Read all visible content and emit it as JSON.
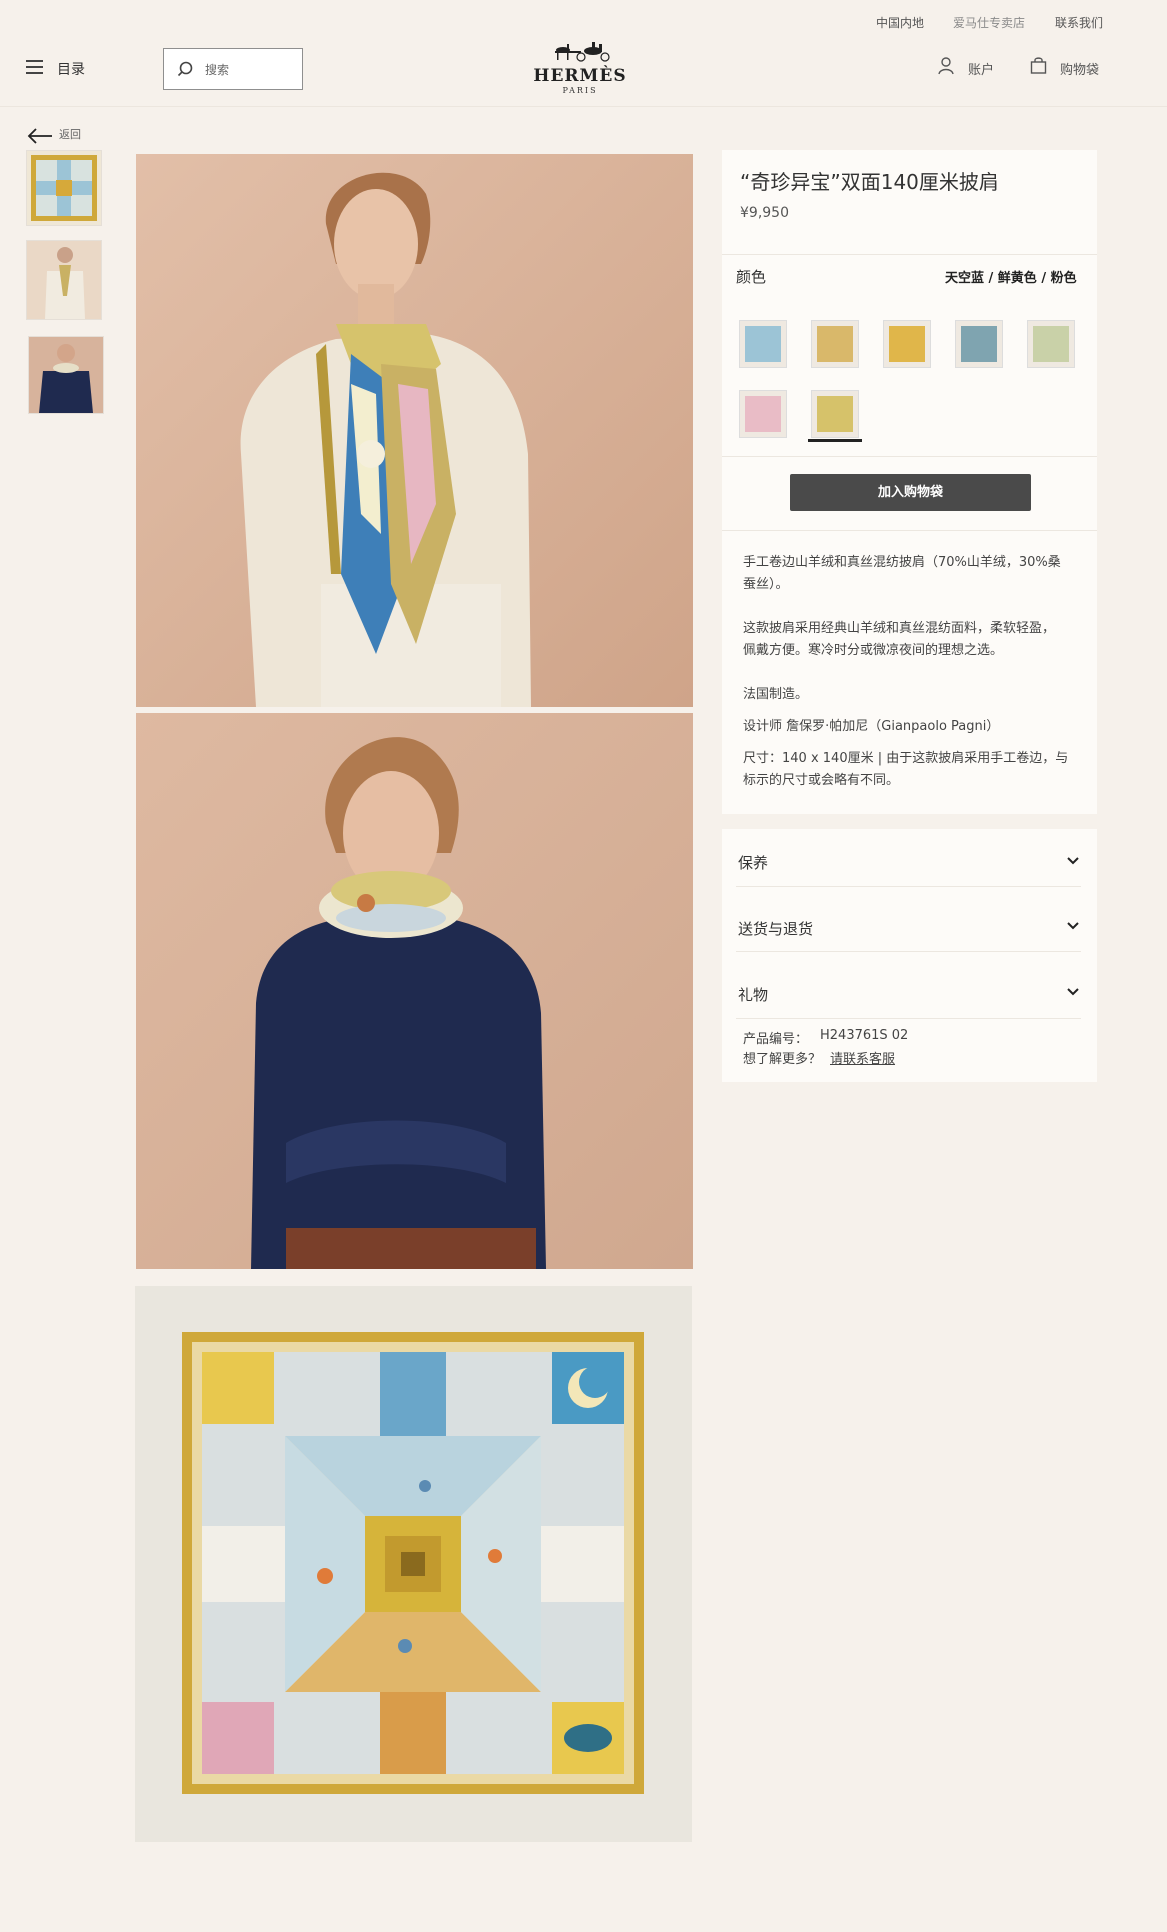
{
  "topbar": {
    "region": "中国内地",
    "store": "爱马仕专卖店",
    "contact": "联系我们"
  },
  "header": {
    "menu_label": "目录",
    "search_placeholder": "搜索",
    "logo_main": "HERMÈS",
    "logo_sub": "PARIS",
    "account_label": "账户",
    "bag_label": "购物袋"
  },
  "nav": {
    "back_label": "返回"
  },
  "product": {
    "title": "“奇珍异宝”双面140厘米披肩",
    "price": "¥9,950",
    "color_label": "颜色",
    "color_value": "天空蓝 / 鲜黄色 / 粉色",
    "swatches": [
      {
        "name": "swatch-1",
        "color": "#9cc4d6"
      },
      {
        "name": "swatch-2",
        "color": "#d9b86a"
      },
      {
        "name": "swatch-3",
        "color": "#e0b64a"
      },
      {
        "name": "swatch-4",
        "color": "#7fa4b0"
      },
      {
        "name": "swatch-5",
        "color": "#c9d1a8"
      },
      {
        "name": "swatch-6",
        "color": "#e9bcc6"
      },
      {
        "name": "swatch-7",
        "color": "#d6c26a"
      }
    ],
    "add_to_bag": "加入购物袋",
    "desc_1a": "手工卷边山羊绒和真丝混纺披肩（70%山羊绒，30%桑",
    "desc_1b": "蚕丝）。",
    "desc_2a": "这款披肩采用经典山羊绒和真丝混纺面料，柔软轻盈，",
    "desc_2b": "佩戴方便。寒冷时分或微凉夜间的理想之选。",
    "desc_3": "法国制造。",
    "desc_4": "设计师 詹保罗·帕加尼（Gianpaolo Pagni）",
    "desc_5a": "尺寸：140 x 140厘米 | 由于这款披肩采用手工卷边，与",
    "desc_5b": "标示的尺寸或会略有不同。"
  },
  "accordion": {
    "care": "保养",
    "delivery": "送货与退货",
    "gift": "礼物",
    "sku_label": "产品编号：",
    "sku_value": "H243761S 02",
    "more_label": "想了解更多？",
    "contact_link": "请联系客服"
  },
  "colors": {
    "background": "#f6f1eb",
    "panel": "#fdfbf8",
    "button": "#4a4a4a",
    "photo_bg": "#dcb49a",
    "sweater": "#1f2a4f",
    "jacket": "#ece3d3"
  }
}
